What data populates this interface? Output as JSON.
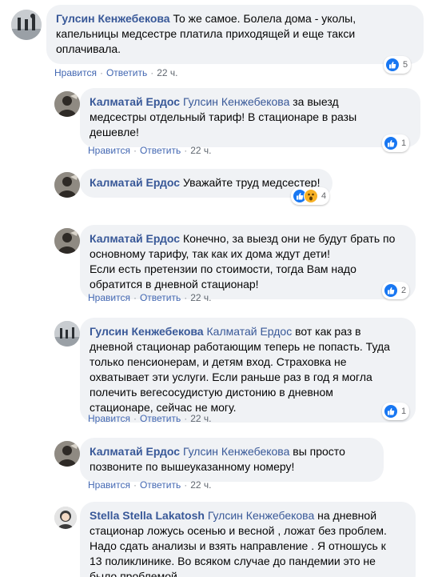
{
  "colors": {
    "link": "#385898",
    "bubble": "#f0f2f5",
    "like_blue": "#1877f2",
    "wow_yellow": "#f7b125",
    "action_gray": "#606770"
  },
  "actions": {
    "like": "Нравится",
    "reply": "Ответить",
    "sep": "·"
  },
  "comments": [
    {
      "author": "Гулсин Кенжебекова",
      "mention": "",
      "lines": [
        "То же самое. Болела дома - уколы,",
        "капельницы медсестре платила приходящей и еще такси",
        "оплачивала."
      ],
      "time": "22 ч.",
      "reactions": {
        "icons": [
          "like-icon"
        ],
        "count": "5"
      }
    },
    {
      "author": "Калматай Ердос",
      "mention": "Гулсин Кенжебекова",
      "lines": [
        "за выезд",
        "медсестры отдельный тариф! В стационаре в разы",
        "дешевле!"
      ],
      "time": "22 ч.",
      "reactions": {
        "icons": [
          "like-icon"
        ],
        "count": "1"
      }
    },
    {
      "author": "Калматай Ердос",
      "mention": "",
      "lines": [
        "Уважайте труд медсестер!"
      ],
      "time": "",
      "reactions": {
        "icons": [
          "like-icon",
          "wow-icon"
        ],
        "count": "4"
      }
    },
    {
      "author": "Калматай Ердос",
      "mention": "",
      "lines": [
        "Конечно, за выезд они не будут брать по",
        "основному тарифу, так как их дома ждут дети!",
        "Если есть претензии по стоимости, тогда Вам надо",
        "обратится в дневной стационар!"
      ],
      "time": "22 ч.",
      "reactions": {
        "icons": [
          "like-icon"
        ],
        "count": "2"
      }
    },
    {
      "author": "Гулсин Кенжебекова",
      "mention": "Калматай Ердос",
      "lines": [
        "вот как раз в",
        "дневной стационар работающим теперь не попасть. Туда",
        "только пенсионерам, и детям вход. Страховка не",
        "охватывает эти услуги. Если раньше раз в год я могла",
        "полечить вегесосудистую дистонию в дневном",
        "стационаре, сейчас не могу."
      ],
      "time": "22 ч.",
      "reactions": {
        "icons": [
          "like-icon"
        ],
        "count": "1"
      }
    },
    {
      "author": "Калматай Ердос",
      "mention": "Гулсин Кенжебекова",
      "lines": [
        "вы просто",
        "позвоните по вышеуказанному номеру!"
      ],
      "time": "22 ч.",
      "reactions": null
    },
    {
      "author": "Stella Stella Lakatosh",
      "mention": "Гулсин Кенжебекова",
      "lines": [
        "на дневной",
        "стационар ложусь осенью и весной , ложат без проблем.",
        "Надо сдать анализы и взять направление . Я отношусь к",
        "13 поликлинике. Во всяком случае до пандемии это не",
        "было проблемой."
      ],
      "time": "",
      "reactions": null
    }
  ]
}
